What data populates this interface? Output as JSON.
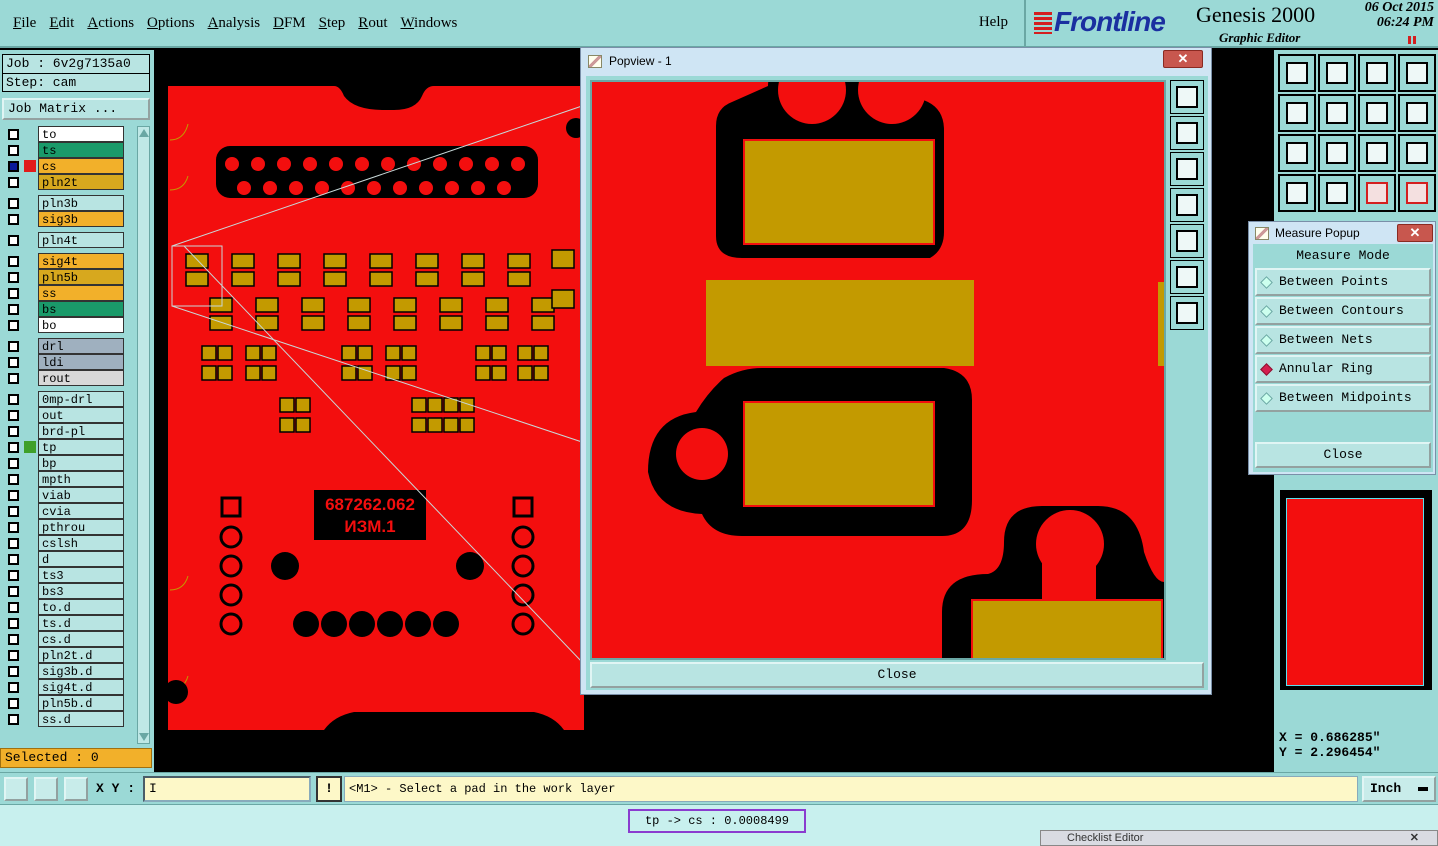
{
  "menu": {
    "items": [
      "File",
      "Edit",
      "Actions",
      "Options",
      "Analysis",
      "DFM",
      "Step",
      "Rout",
      "Windows"
    ],
    "help": "Help"
  },
  "brand": {
    "logo": "Frontline",
    "product": "Genesis 2000",
    "subtitle": "Graphic Editor",
    "date": "06 Oct 2015",
    "time": "06:24 PM"
  },
  "job": {
    "job_line": "Job : 6v2g7135a0",
    "step_line": "Step: cam",
    "matrix_button": "Job Matrix ..."
  },
  "layers": [
    {
      "name": "to",
      "color": "#ffffff",
      "group": 1
    },
    {
      "name": "ts",
      "color": "#1a9a6a",
      "group": 1
    },
    {
      "name": "cs",
      "color": "#f2b02a",
      "group": 1,
      "selected": true,
      "swatch": "#e11b1b"
    },
    {
      "name": "pln2t",
      "color": "#d7a81e",
      "group": 1
    },
    {
      "name": "pln3b",
      "color": "#b8e4e2",
      "group": 2
    },
    {
      "name": "sig3b",
      "color": "#f2b02a",
      "group": 2
    },
    {
      "name": "pln4t",
      "color": "#b8e4e2",
      "group": 3
    },
    {
      "name": "sig4t",
      "color": "#f2b02a",
      "group": 4
    },
    {
      "name": "pln5b",
      "color": "#d7a81e",
      "group": 4
    },
    {
      "name": "ss",
      "color": "#f2b02a",
      "group": 4
    },
    {
      "name": "bs",
      "color": "#1a9a6a",
      "group": 4
    },
    {
      "name": "bo",
      "color": "#ffffff",
      "group": 4
    },
    {
      "name": "drl",
      "color": "#9fb0bf",
      "group": 5
    },
    {
      "name": "ldi",
      "color": "#9fb0bf",
      "group": 5
    },
    {
      "name": "rout",
      "color": "#d8d8d8",
      "group": 5
    },
    {
      "name": "0mp-drl",
      "color": "#b8e4e2",
      "group": 6
    },
    {
      "name": "out",
      "color": "#b8e4e2",
      "group": 6
    },
    {
      "name": "brd-pl",
      "color": "#b8e4e2",
      "group": 6
    },
    {
      "name": "tp",
      "color": "#b8e4e2",
      "group": 6,
      "swatch": "#3fa02a"
    },
    {
      "name": "bp",
      "color": "#b8e4e2",
      "group": 6
    },
    {
      "name": "mpth",
      "color": "#b8e4e2",
      "group": 6
    },
    {
      "name": "viab",
      "color": "#b8e4e2",
      "group": 6
    },
    {
      "name": "cvia",
      "color": "#b8e4e2",
      "group": 6
    },
    {
      "name": "pthrou",
      "color": "#b8e4e2",
      "group": 6
    },
    {
      "name": "cslsh",
      "color": "#b8e4e2",
      "group": 6
    },
    {
      "name": "d",
      "color": "#b8e4e2",
      "group": 6
    },
    {
      "name": "ts3",
      "color": "#b8e4e2",
      "group": 6
    },
    {
      "name": "bs3",
      "color": "#b8e4e2",
      "group": 6
    },
    {
      "name": "to.d",
      "color": "#b8e4e2",
      "group": 6
    },
    {
      "name": "ts.d",
      "color": "#b8e4e2",
      "group": 6
    },
    {
      "name": "cs.d",
      "color": "#b8e4e2",
      "group": 6
    },
    {
      "name": "pln2t.d",
      "color": "#b8e4e2",
      "group": 6
    },
    {
      "name": "sig3b.d",
      "color": "#b8e4e2",
      "group": 6
    },
    {
      "name": "sig4t.d",
      "color": "#b8e4e2",
      "group": 6
    },
    {
      "name": "pln5b.d",
      "color": "#b8e4e2",
      "group": 6
    },
    {
      "name": "ss.d",
      "color": "#b8e4e2",
      "group": 6
    }
  ],
  "selected_count": "Selected : 0",
  "board": {
    "text_line1": "687262.062",
    "text_line2": "ИЗМ.1"
  },
  "popview": {
    "title": "Popview - 1",
    "close_label": "Close",
    "close_x": "✕"
  },
  "measure": {
    "title": "Measure Popup",
    "heading": "Measure Mode",
    "options": [
      "Between Points",
      "Between Contours",
      "Between Nets",
      "Annular Ring",
      "Between Midpoints"
    ],
    "active_option": "Annular Ring",
    "close_label": "Close",
    "close_x": "✕"
  },
  "coords": {
    "x": "X = 0.686285\"",
    "y": "Y = 2.296454\""
  },
  "toolbar": {
    "xy_label": "X Y :",
    "xy_value": "I",
    "warn": "!",
    "prompt": "<M1> - Select a pad in the work layer",
    "units": "Inch"
  },
  "status": {
    "result": "tp -> cs : 0.0008499"
  },
  "checklist": {
    "title": "Checklist Editor",
    "close_x": "✕"
  },
  "colors": {
    "copper": "#f30e0e",
    "pad": "#c39a00",
    "panel": "#9bd9d6"
  }
}
